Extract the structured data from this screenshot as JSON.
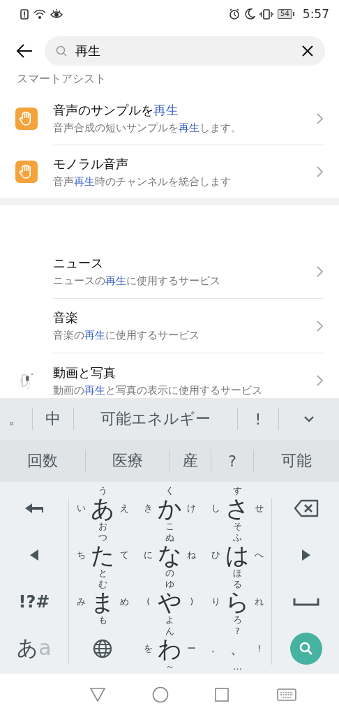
{
  "status_bar": {
    "battery": "54",
    "time": "5:57"
  },
  "search": {
    "value": "再生"
  },
  "section_title": "スマートアシスト",
  "assist_results": [
    {
      "kind": "assist",
      "title": [
        {
          "text": "音声のサンプルを",
          "match": false
        },
        {
          "text": "再生",
          "match": true
        }
      ],
      "subtitle": [
        {
          "text": "音声合成の短いサンプルを",
          "match": false
        },
        {
          "text": "再生",
          "match": true
        },
        {
          "text": "します。",
          "match": false
        }
      ]
    },
    {
      "kind": "assist",
      "title": [
        {
          "text": "モノラル音声",
          "match": false
        }
      ],
      "subtitle": [
        {
          "text": "音声",
          "match": false
        },
        {
          "text": "再生",
          "match": true
        },
        {
          "text": "時のチャンネルを統合します",
          "match": false
        }
      ]
    }
  ],
  "service_results": [
    {
      "kind": "plain",
      "title": [
        {
          "text": "ニュース",
          "match": false
        }
      ],
      "subtitle": [
        {
          "text": "ニュースの",
          "match": false
        },
        {
          "text": "再生",
          "match": true
        },
        {
          "text": "に使用するサービス",
          "match": false
        }
      ]
    },
    {
      "kind": "plain",
      "title": [
        {
          "text": "音楽",
          "match": false
        }
      ],
      "subtitle": [
        {
          "text": "音楽の",
          "match": false
        },
        {
          "text": "再生",
          "match": true
        },
        {
          "text": "に使用するサービス",
          "match": false
        }
      ]
    },
    {
      "kind": "app",
      "title": [
        {
          "text": "動画と写真",
          "match": false
        }
      ],
      "subtitle": [
        {
          "text": "動画の",
          "match": false
        },
        {
          "text": "再生",
          "match": true
        },
        {
          "text": "と写真の表示に使用するサービス",
          "match": false
        }
      ]
    }
  ],
  "keyboard": {
    "candidates_top": [
      "。",
      "中",
      "可能エネルギー",
      "!"
    ],
    "candidates_bottom": [
      "回数",
      "医療",
      "産",
      "?",
      "可能"
    ],
    "left_keys": [
      {
        "kind": "undo"
      },
      {
        "kind": "left"
      },
      {
        "kind": "text",
        "label": "!?#"
      },
      {
        "kind": "mode",
        "label": "あ",
        "sub": "a"
      }
    ],
    "kana_keys": [
      {
        "kind": "kana",
        "main": "あ",
        "top": "う",
        "left": "い",
        "right": "え",
        "bottom": "お"
      },
      {
        "kind": "kana",
        "main": "か",
        "top": "く",
        "left": "き",
        "right": "け",
        "bottom": "こ"
      },
      {
        "kind": "kana",
        "main": "さ",
        "top": "す",
        "left": "し",
        "right": "せ",
        "bottom": "そ"
      },
      {
        "kind": "kana",
        "main": "た",
        "top": "つ",
        "left": "ち",
        "right": "て",
        "bottom": "と"
      },
      {
        "kind": "kana",
        "main": "な",
        "top": "ぬ",
        "left": "に",
        "right": "ね",
        "bottom": "の"
      },
      {
        "kind": "kana",
        "main": "は",
        "top": "ふ",
        "left": "ひ",
        "right": "へ",
        "bottom": "ほ"
      },
      {
        "kind": "kana",
        "main": "ま",
        "top": "む",
        "left": "み",
        "right": "め",
        "bottom": "も"
      },
      {
        "kind": "kana",
        "main": "や",
        "top": "ゆ",
        "left": "(",
        "right": ")",
        "bottom": "よ"
      },
      {
        "kind": "kana",
        "main": "ら",
        "top": "る",
        "left": "り",
        "right": "れ",
        "bottom": "ろ"
      },
      {
        "kind": "globe"
      },
      {
        "kind": "kana",
        "main": "わ",
        "top": "ん",
        "left": "を",
        "right": "ー",
        "bottom": "～"
      },
      {
        "kind": "punct",
        "main": "、",
        "top": "?",
        "left": "。",
        "right": "!",
        "bottom": "…"
      }
    ],
    "right_keys": [
      {
        "kind": "backspace"
      },
      {
        "kind": "right"
      },
      {
        "kind": "space"
      },
      {
        "kind": "search"
      }
    ]
  }
}
